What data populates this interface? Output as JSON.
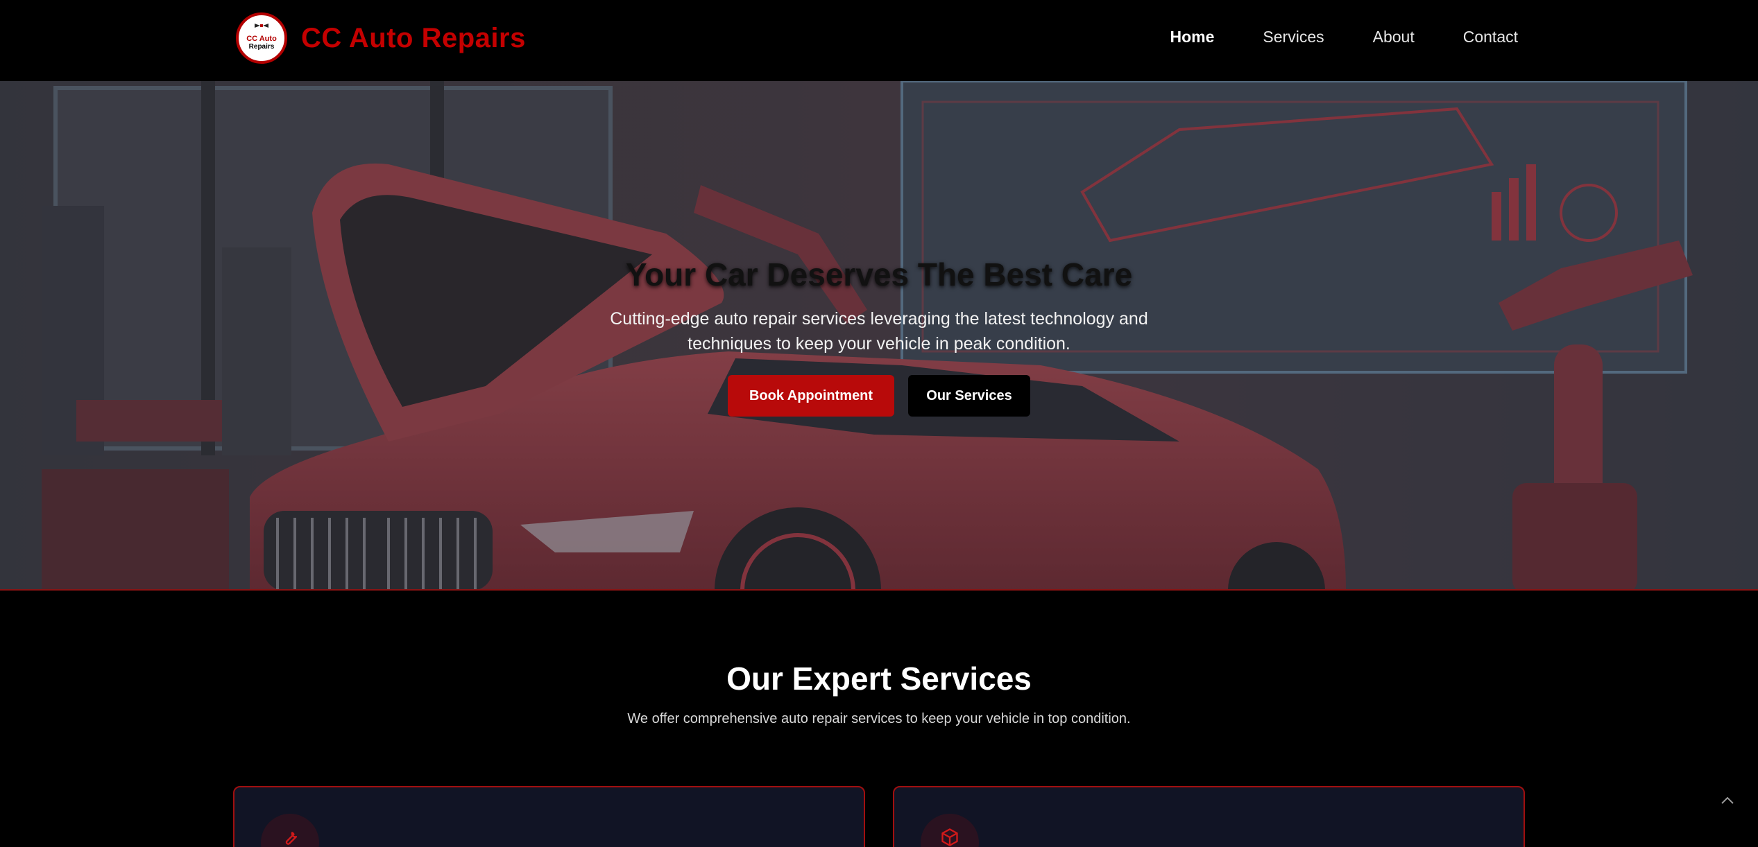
{
  "brand": {
    "name": "CC Auto Repairs",
    "logo_line1": "CC Auto",
    "logo_line2": "Repairs"
  },
  "nav": {
    "items": [
      {
        "label": "Home",
        "active": true
      },
      {
        "label": "Services",
        "active": false
      },
      {
        "label": "About",
        "active": false
      },
      {
        "label": "Contact",
        "active": false
      }
    ]
  },
  "hero": {
    "title": "Your Car Deserves The Best Care",
    "subtitle": "Cutting-edge auto repair services leveraging the latest technology and techniques to keep your vehicle in peak condition.",
    "primary_button": "Book Appointment",
    "secondary_button": "Our Services"
  },
  "services": {
    "title": "Our Expert Services",
    "subtitle": "We offer comprehensive auto repair services to keep your vehicle in top condition.",
    "cards": [
      {
        "icon": "wrench-icon"
      },
      {
        "icon": "box-icon"
      }
    ]
  },
  "colors": {
    "accent": "#b80a0a",
    "brand_red": "#c40000",
    "card_bg": "#111425",
    "background": "#000000"
  },
  "scroll_top_icon": "chevron-up-icon"
}
